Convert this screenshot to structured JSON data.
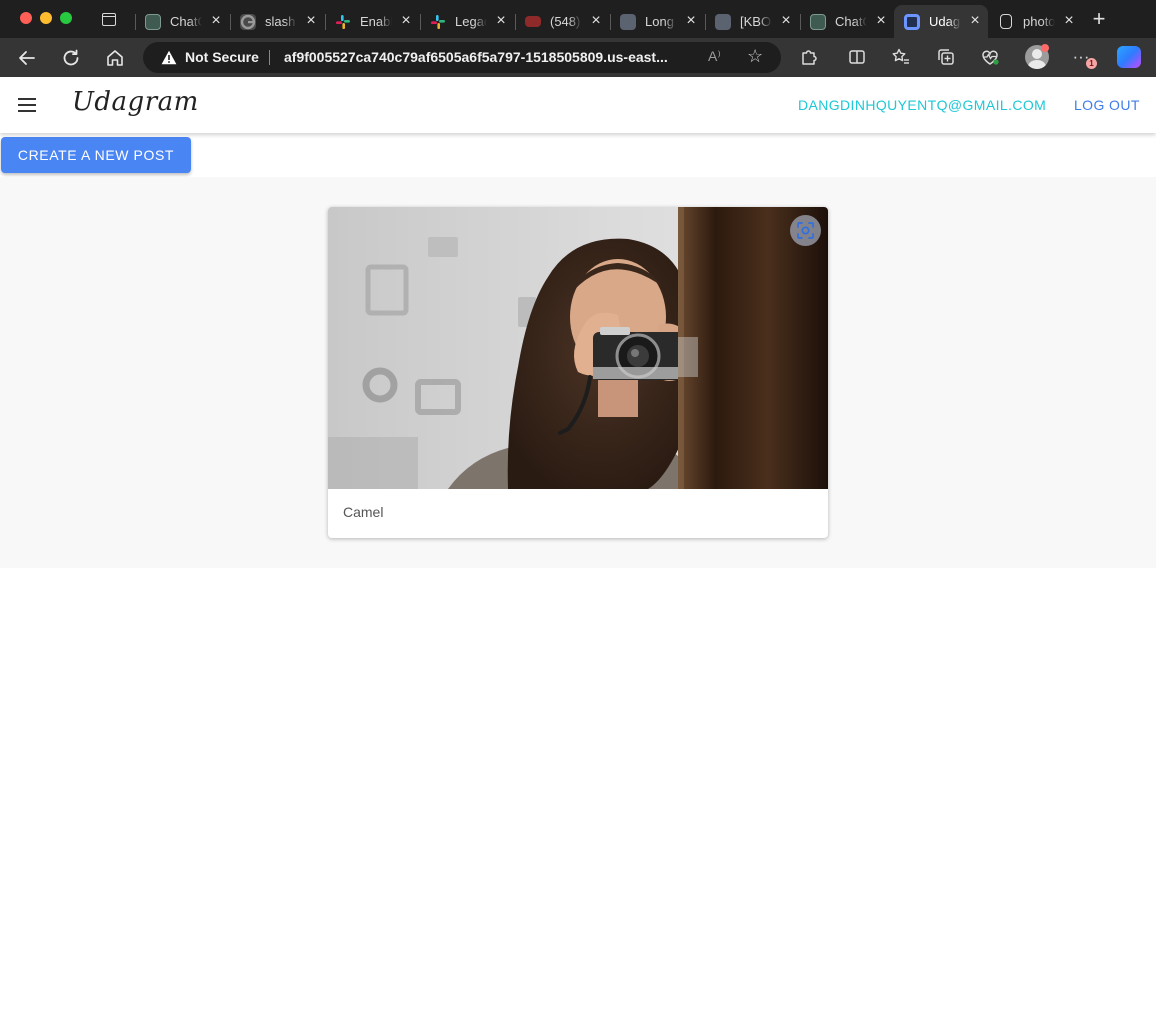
{
  "browser": {
    "tabs": [
      {
        "title": "ChatGPT",
        "icon": "chatgpt-icon"
      },
      {
        "title": "slash command",
        "icon": "google-icon"
      },
      {
        "title": "Enable",
        "icon": "slack-icon"
      },
      {
        "title": "Legacy",
        "icon": "slack-icon"
      },
      {
        "title": "(548)",
        "icon": "youtube-icon"
      },
      {
        "title": "Long",
        "icon": "globe-icon"
      },
      {
        "title": "[KBO",
        "icon": "globe-icon"
      },
      {
        "title": "ChatGPT",
        "icon": "chatgpt-icon"
      },
      {
        "title": "Udagram",
        "icon": "udagram-icon",
        "active": true
      },
      {
        "title": "photo",
        "icon": "file-icon"
      }
    ],
    "address_bar": {
      "security_label": "Not Secure",
      "url": "af9f005527ca740c79af6505a6f5a797-1518505809.us-east...",
      "read_aloud": "A⁾"
    },
    "more_badge": "1"
  },
  "header": {
    "brand": "Udagram",
    "user_email": "DANGDINHQUYENTQ@GMAIL.COM",
    "logout_label": "LOG OUT"
  },
  "actions": {
    "create_post_label": "CREATE A NEW POST"
  },
  "feed": {
    "posts": [
      {
        "caption": "Camel",
        "image": "woman holding camera photo"
      }
    ]
  },
  "colors": {
    "primary": "#4a85f4",
    "email": "#1ec8d6",
    "logout": "#3f7ee8",
    "feed_bg": "#f8f8f8"
  }
}
